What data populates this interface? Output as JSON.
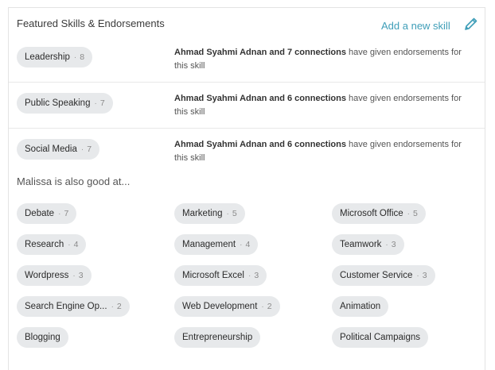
{
  "header": {
    "title": "Featured Skills & Endorsements",
    "add_label": "Add a new skill",
    "edit_icon": "pencil-icon"
  },
  "featured": [
    {
      "name": "Leadership",
      "count": "8",
      "endorsers": "Ahmad Syahmi Adnan and 7 connections",
      "suffix": " have given endorsements for this skill"
    },
    {
      "name": "Public Speaking",
      "count": "7",
      "endorsers": "Ahmad Syahmi Adnan and 6 connections",
      "suffix": " have given endorsements for this skill"
    },
    {
      "name": "Social Media",
      "count": "7",
      "endorsers": "Ahmad Syahmi Adnan and 6 connections",
      "suffix": " have given endorsements for this skill"
    }
  ],
  "also_good_label": "Malissa is also good at...",
  "other_skills": [
    {
      "name": "Debate",
      "count": "7"
    },
    {
      "name": "Marketing",
      "count": "5"
    },
    {
      "name": "Microsoft Office",
      "count": "5"
    },
    {
      "name": "Research",
      "count": "4"
    },
    {
      "name": "Management",
      "count": "4"
    },
    {
      "name": "Teamwork",
      "count": "3"
    },
    {
      "name": "Wordpress",
      "count": "3"
    },
    {
      "name": "Microsoft Excel",
      "count": "3"
    },
    {
      "name": "Customer Service",
      "count": "3"
    },
    {
      "name": "Search Engine Op...",
      "count": "2"
    },
    {
      "name": "Web Development",
      "count": "2"
    },
    {
      "name": "Animation",
      "count": ""
    },
    {
      "name": "Blogging",
      "count": ""
    },
    {
      "name": "Entrepreneurship",
      "count": ""
    },
    {
      "name": "Political Campaigns",
      "count": ""
    }
  ],
  "colors": {
    "accent": "#3f9eb8",
    "pill_bg": "#e7e9eb",
    "divider": "#e8e8e8"
  }
}
